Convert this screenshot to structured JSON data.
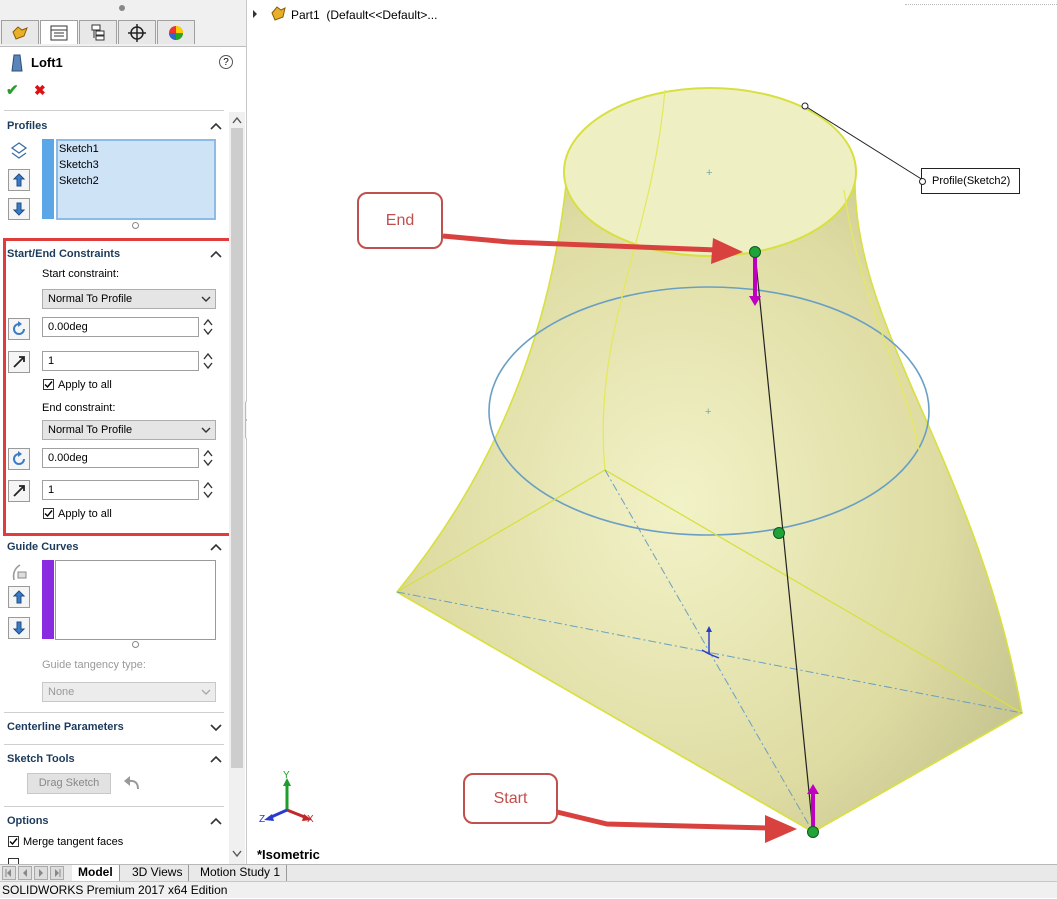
{
  "feature_tree_tabs": [
    "feature-manager-icon",
    "property-manager-icon",
    "configuration-manager-icon",
    "dimxpert-icon",
    "display-manager-icon"
  ],
  "feature": {
    "title": "Loft1",
    "help": "?"
  },
  "actions": {
    "ok": "✔",
    "cancel": "✖"
  },
  "profiles": {
    "title": "Profiles",
    "items": [
      "Sketch1",
      "Sketch3",
      "Sketch2"
    ],
    "color": "#5aa6e6"
  },
  "constraints": {
    "title": "Start/End Constraints",
    "start_label": "Start constraint:",
    "start_value": "Normal To Profile",
    "start_angle": "0.00deg",
    "start_length": "1",
    "start_apply_all": "Apply to all",
    "end_label": "End constraint:",
    "end_value": "Normal To Profile",
    "end_angle": "0.00deg",
    "end_length": "1",
    "end_apply_all": "Apply to all",
    "highlight_color": "#e03c3c"
  },
  "guide_curves": {
    "title": "Guide Curves",
    "tangency_label": "Guide tangency type:",
    "tangency_value": "None",
    "color": "#8a2be2"
  },
  "centerline": {
    "title": "Centerline Parameters"
  },
  "sketch_tools": {
    "title": "Sketch Tools",
    "drag_sketch": "Drag Sketch"
  },
  "options": {
    "title": "Options",
    "merge_tangent": "Merge tangent faces"
  },
  "viewport": {
    "breadcrumb": "Part1  (Default<<Default>...",
    "profile_tag": "Profile(Sketch2)",
    "view_label": "*Isometric",
    "triad": {
      "x": "X",
      "y": "Y",
      "z": "Z"
    },
    "callout_end": "End",
    "callout_start": "Start",
    "accent_color": "#d9413f",
    "connector_color": "#c000c0",
    "point_color": "#1fa33a"
  },
  "bottom_tabs": [
    "Model",
    "3D Views",
    "Motion Study 1"
  ],
  "status": "SOLIDWORKS Premium 2017 x64 Edition"
}
